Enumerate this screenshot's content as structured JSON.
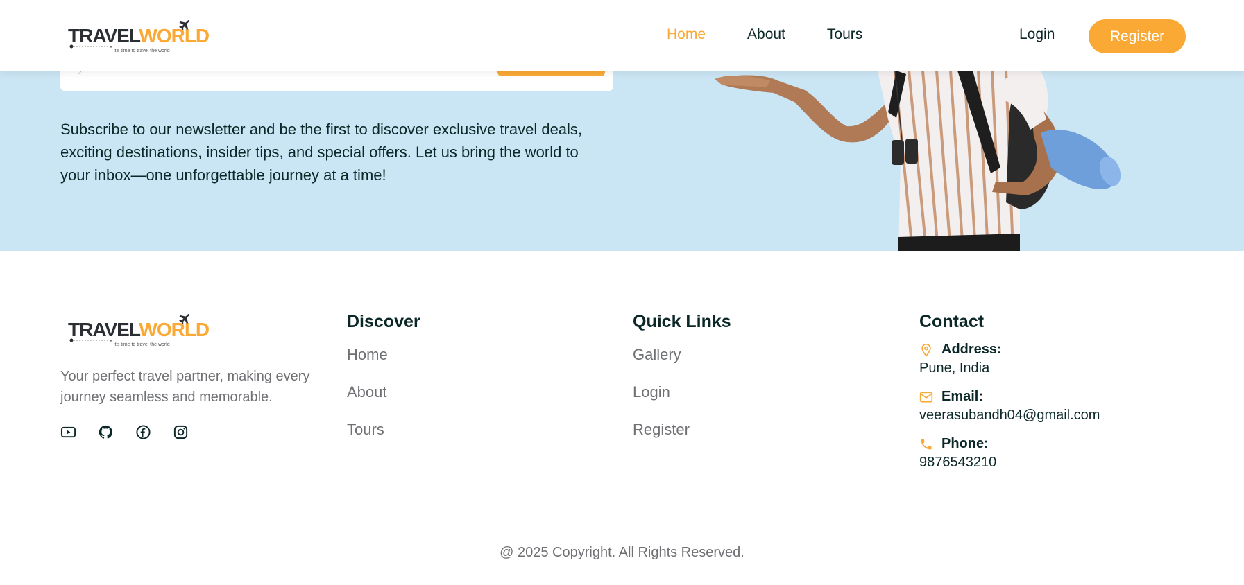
{
  "header": {
    "logo": {
      "part1": "TRAVEL",
      "part2": "WORLD",
      "tagline": "it's time to travel the world"
    },
    "nav": [
      {
        "label": "Home",
        "active": true
      },
      {
        "label": "About",
        "active": false
      },
      {
        "label": "Tours",
        "active": false
      }
    ],
    "login_label": "Login",
    "register_label": "Register"
  },
  "newsletter": {
    "input_placeholder_partial": "y",
    "description": "Subscribe to our newsletter and be the first to discover exclusive travel deals, exciting destinations, insider tips, and special offers. Let us bring the world to your inbox—one unforgettable journey at a time!"
  },
  "footer": {
    "about_text": "Your perfect travel partner, making every journey seamless and memorable.",
    "socials": [
      "youtube-icon",
      "github-icon",
      "facebook-icon",
      "instagram-icon"
    ],
    "discover": {
      "title": "Discover",
      "links": [
        "Home",
        "About",
        "Tours"
      ]
    },
    "quick_links": {
      "title": "Quick Links",
      "links": [
        "Gallery",
        "Login",
        "Register"
      ]
    },
    "contact": {
      "title": "Contact",
      "address_label": "Address:",
      "address_value": "Pune, India",
      "email_label": "Email:",
      "email_value": "veerasubandh04@gmail.com",
      "phone_label": "Phone:",
      "phone_value": "9876543210"
    },
    "copyright": "@ 2025 Copyright. All Rights Reserved."
  },
  "colors": {
    "accent": "#faa935",
    "heading": "#0b2727",
    "text_muted": "#6e7074",
    "newsletter_bg": "#cae5f4"
  }
}
